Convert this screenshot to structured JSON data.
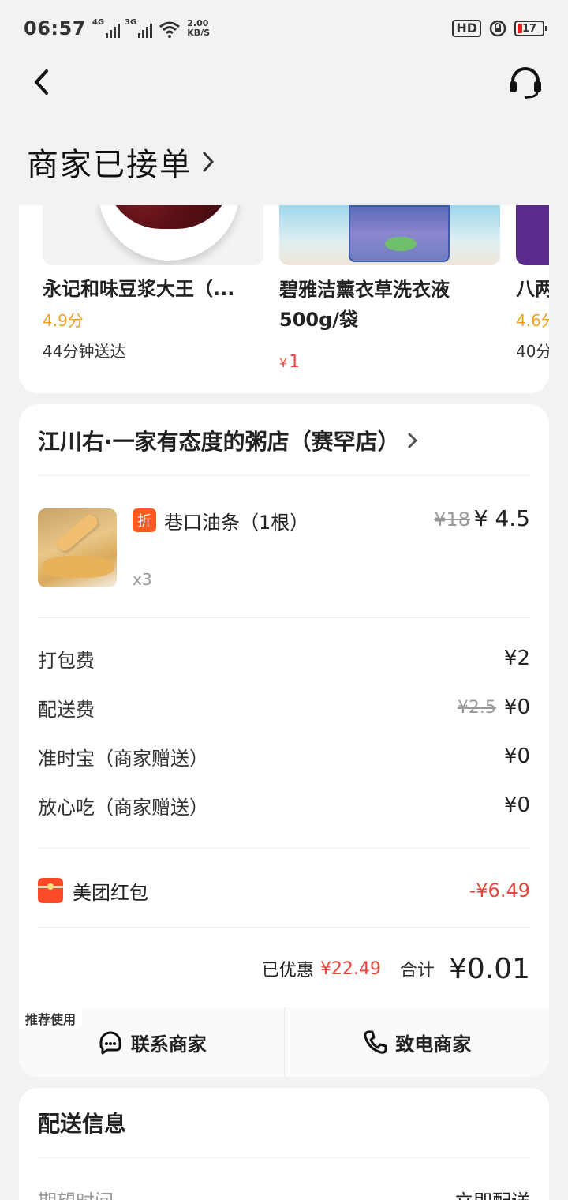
{
  "status_bar": {
    "time": "06:57",
    "net1": "4G",
    "net2": "3G",
    "speed_value": "2.00",
    "speed_unit": "KB/S",
    "hd": "HD",
    "battery": "17"
  },
  "order": {
    "status": "商家已接单"
  },
  "recommendations": [
    {
      "name": "永记和味豆浆大王（...",
      "score": "4.9分",
      "eta": "44分钟送达"
    },
    {
      "name": "碧雅洁薰衣草洗衣液500g/袋",
      "price_symbol": "¥",
      "price": "1"
    },
    {
      "name": "八两",
      "score": "4.6分",
      "eta": "40分"
    }
  ],
  "store": {
    "name": "江川右·一家有态度的粥店（赛罕店）"
  },
  "item": {
    "tag": "折",
    "name": "巷口油条（1根）",
    "qty": "x3",
    "original_price": "¥18",
    "price": "¥ 4.5"
  },
  "fees": [
    {
      "label": "打包费",
      "original": "",
      "value": "¥2"
    },
    {
      "label": "配送费",
      "original": "¥2.5",
      "value": "¥0"
    },
    {
      "label": "准时宝（商家赠送）",
      "original": "",
      "value": "¥0"
    },
    {
      "label": "放心吃（商家赠送）",
      "original": "",
      "value": "¥0"
    }
  ],
  "red_packet": {
    "label": "美团红包",
    "value": "-¥6.49"
  },
  "summary": {
    "saved_label": "已优惠",
    "saved_value": "¥22.49",
    "total_label": "合计",
    "total_value": "¥0.01"
  },
  "actions": {
    "recommend_tag": "推荐使用",
    "contact": "联系商家",
    "call": "致电商家"
  },
  "delivery": {
    "title": "配送信息",
    "label": "期望时间",
    "value": "立即配送"
  },
  "colors": {
    "accent_red": "#e8453c",
    "score_orange": "#f0a020",
    "tag_orange": "#ff5a1f"
  },
  "icons": [
    "back-arrow-icon",
    "headset-icon",
    "chevron-right-icon",
    "chat-icon",
    "phone-icon",
    "red-packet-icon"
  ]
}
